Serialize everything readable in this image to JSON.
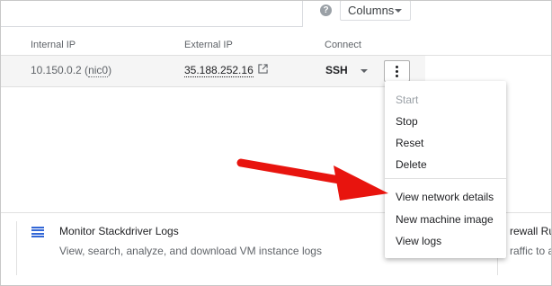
{
  "toolbar": {
    "help_glyph": "?",
    "columns_label": "Columns"
  },
  "table": {
    "headers": [
      "Internal IP",
      "External IP",
      "Connect"
    ],
    "row": {
      "internal_ip": "10.150.0.2",
      "nic_prefix": " (",
      "nic": "nic0",
      "nic_suffix": ")",
      "external_ip": "35.188.252.16",
      "connect": "SSH"
    }
  },
  "menu": {
    "items": [
      {
        "label": "Start",
        "enabled": false
      },
      {
        "label": "Stop",
        "enabled": true
      },
      {
        "label": "Reset",
        "enabled": true
      },
      {
        "label": "Delete",
        "enabled": true
      },
      {
        "label": "View network details",
        "enabled": true
      },
      {
        "label": "New machine image",
        "enabled": true
      },
      {
        "label": "View logs",
        "enabled": true
      }
    ]
  },
  "cards": [
    {
      "title": "Monitor Stackdriver Logs",
      "description": "View, search, analyze, and download VM instance logs",
      "icon": "list-icon"
    },
    {
      "title": "rewall Rul",
      "description": "raffic to a"
    }
  ],
  "colors": {
    "accent_blue": "#3367d6",
    "annotation_red": "#e8140e"
  }
}
